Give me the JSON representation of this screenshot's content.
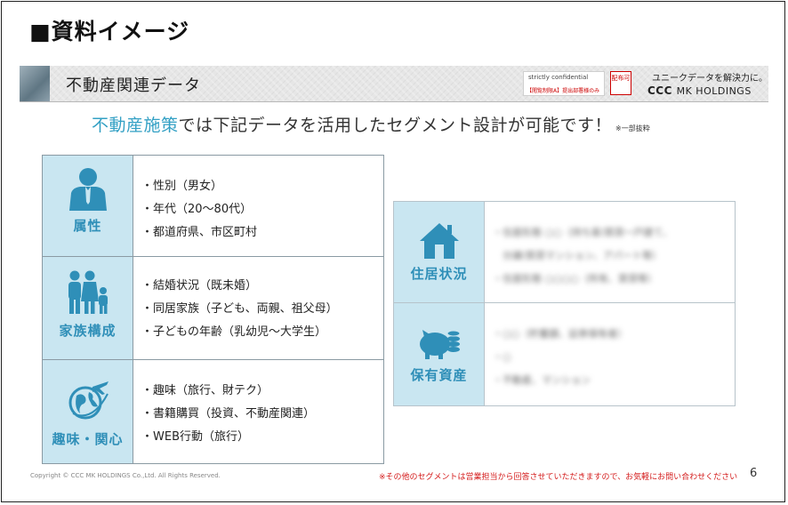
{
  "page_title": "■資料イメージ",
  "banner": {
    "title": "不動産関連データ",
    "confidential_label": "strictly confidential",
    "confidential_note": "【閲覧制限A】提出部署様のみ",
    "distribution_label": "配布可",
    "tagline": "ユニークデータを解決力に。",
    "logo_main": "CCC",
    "logo_sub": "MK HOLDINGS"
  },
  "headline": {
    "highlight": "不動産施策",
    "rest": "では下記データを活用したセグメント設計が可能です！",
    "note": "※一部抜粋"
  },
  "left_table": [
    {
      "category": "属性",
      "icon": "person-icon",
      "items": [
        "・性別（男女）",
        "・年代（20〜80代）",
        "・都道府県、市区町村"
      ]
    },
    {
      "category": "家族構成",
      "icon": "family-icon",
      "items": [
        "・結婚状況（既未婚）",
        "・同居家族（子ども、両親、祖父母）",
        "・子どもの年齢（乳幼児〜大学生）"
      ]
    },
    {
      "category": "趣味・関心",
      "icon": "travel-globe-icon",
      "items": [
        "・趣味（旅行、財テク）",
        "・書籍購買（投資、不動産関連）",
        "・WEB行動（旅行）"
      ]
    }
  ],
  "right_table": [
    {
      "category": "住居状況",
      "icon": "house-icon",
      "items": [
        "・住居形態 ○○（持ち家/賃貸一戸建て、",
        "　分譲/賃貸マンション、アパート等）",
        "・住居形態 ○○○○（所有、賃貸等）"
      ]
    },
    {
      "category": "保有資産",
      "icon": "piggy-bank-icon",
      "items": [
        "・○○（貯蓄額、証券保有者）",
        "・○",
        "・不動産、マンション"
      ]
    }
  ],
  "footer": {
    "copyright": "Copyright © CCC MK HOLDINGS Co.,Ltd. All Rights Reserved.",
    "footnote": "※その他のセグメントは営業担当から回答させていただきますので、お気軽にお問い合わせください",
    "page_number": "6"
  },
  "colors": {
    "accent": "#33a0c4",
    "category_bg": "#c9e6f1",
    "footnote": "#d41c1c"
  }
}
